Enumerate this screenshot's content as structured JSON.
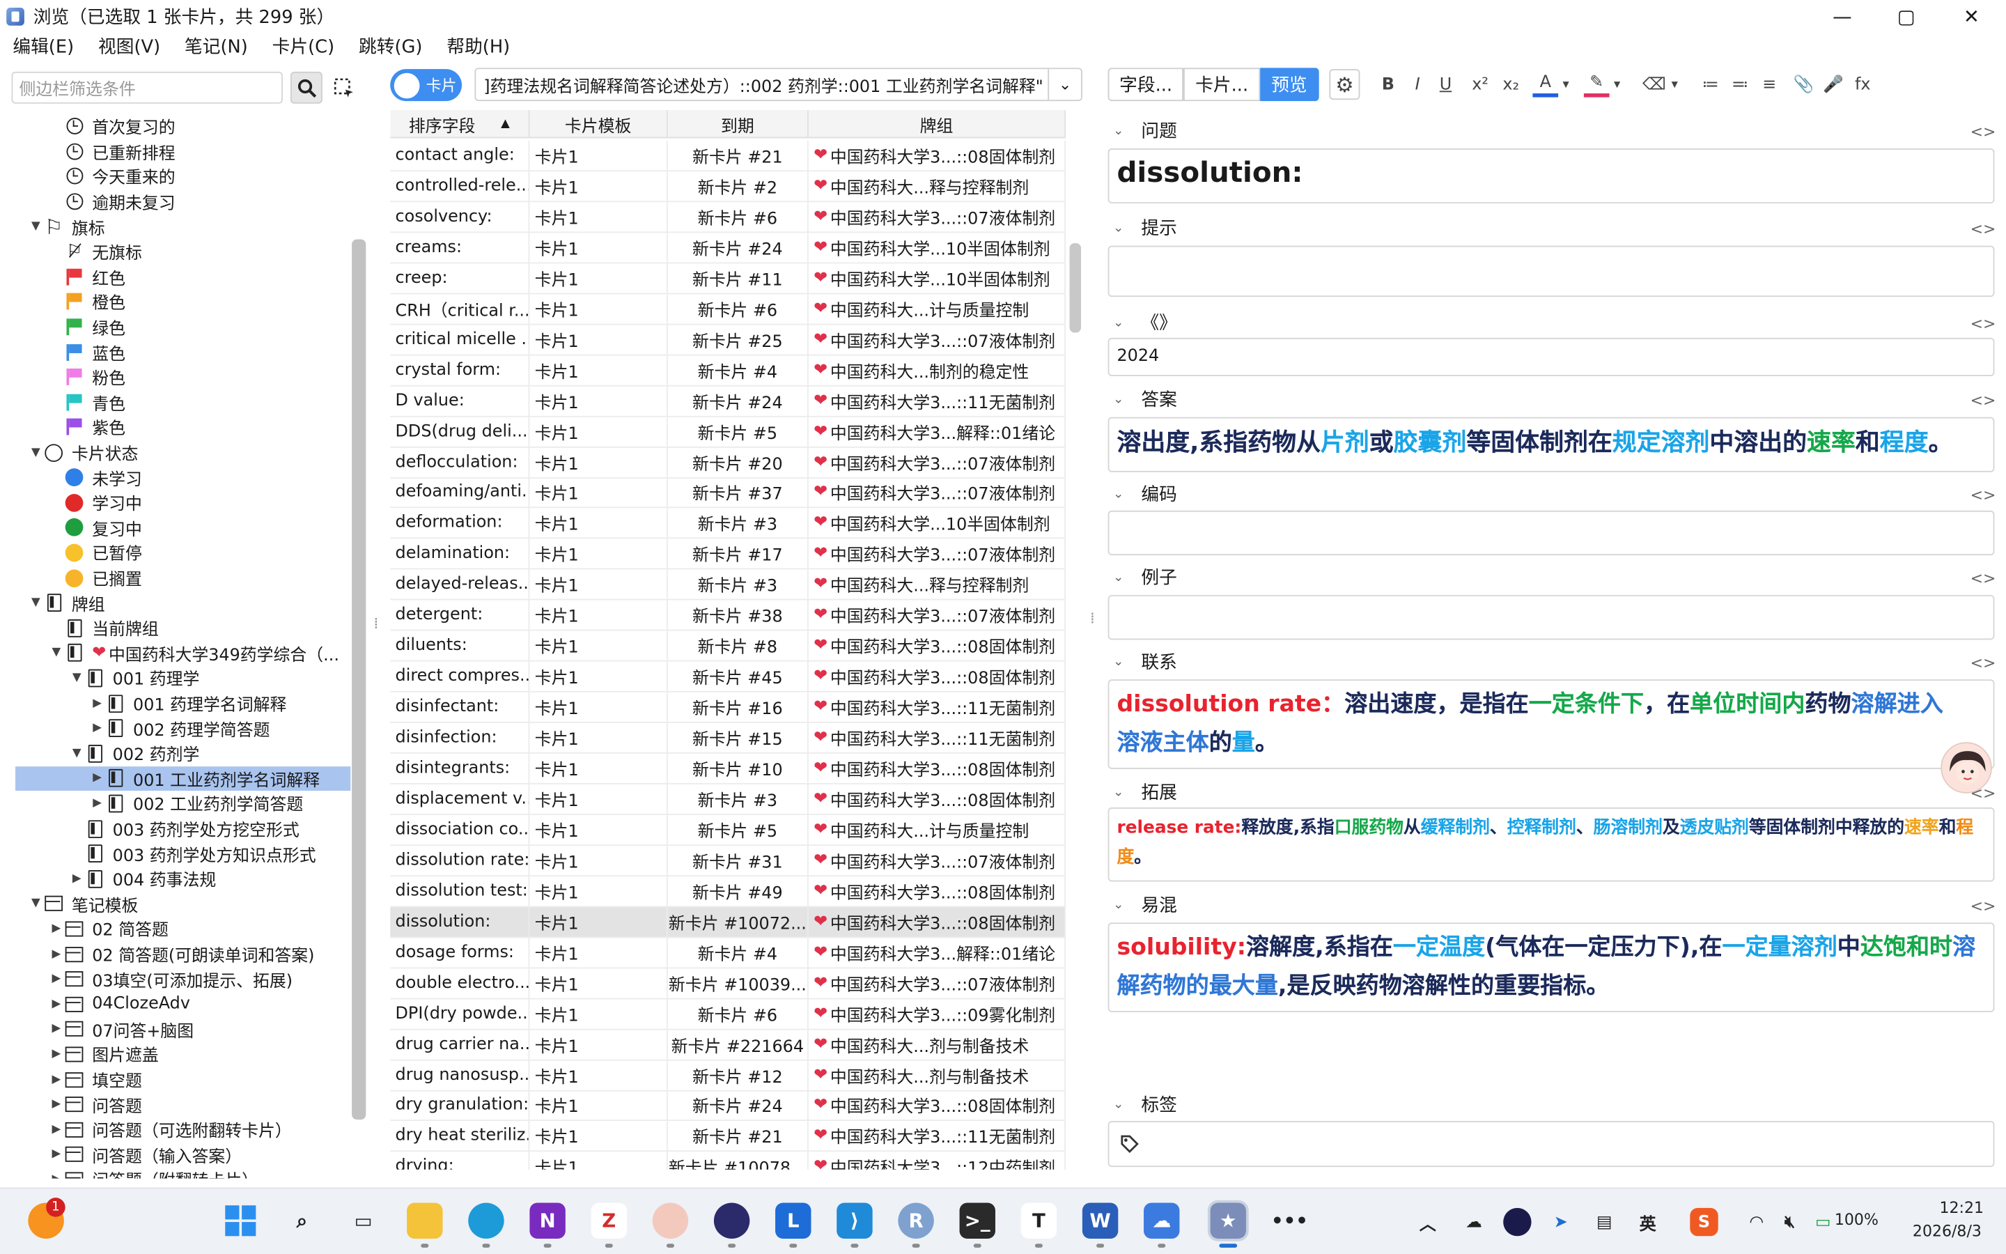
{
  "window": {
    "title": "浏览（已选取 1 张卡片，共 299 张）",
    "controls": [
      "—",
      "▢",
      "✕"
    ]
  },
  "menu": [
    "编辑(E)",
    "视图(V)",
    "笔记(N)",
    "卡片(C)",
    "跳转(G)",
    "帮助(H)"
  ],
  "sidebar": {
    "search_placeholder": "侧边栏筛选条件",
    "rows": [
      {
        "label": "首次复习的",
        "icon": "clock-icon",
        "indent": 1
      },
      {
        "label": "已重新排程",
        "icon": "clock-icon",
        "indent": 1
      },
      {
        "label": "今天重来的",
        "icon": "clock-icon",
        "indent": 1
      },
      {
        "label": "逾期未复习",
        "icon": "clock-icon",
        "indent": 1
      },
      {
        "label": "旗标",
        "icon": "flag-icon",
        "indent": 0,
        "expander": "▼"
      },
      {
        "label": "无旗标",
        "icon": "no-flag-icon",
        "indent": 1
      },
      {
        "label": "红色",
        "icon": "red-flag-icon",
        "indent": 1,
        "color": "#e8383d"
      },
      {
        "label": "橙色",
        "icon": "orange-flag-icon",
        "indent": 1,
        "color": "#f5a022"
      },
      {
        "label": "绿色",
        "icon": "green-flag-icon",
        "indent": 1,
        "color": "#33b24b"
      },
      {
        "label": "蓝色",
        "icon": "blue-flag-icon",
        "indent": 1,
        "color": "#3a8ee6"
      },
      {
        "label": "粉色",
        "icon": "pink-flag-icon",
        "indent": 1,
        "color": "#f07ce6"
      },
      {
        "label": "青色",
        "icon": "teal-flag-icon",
        "indent": 1,
        "color": "#27c4c4"
      },
      {
        "label": "紫色",
        "icon": "purple-flag-icon",
        "indent": 1,
        "color": "#9b4ee8"
      },
      {
        "label": "卡片状态",
        "icon": "circle-icon",
        "indent": 0,
        "expander": "▼"
      },
      {
        "label": "未学习",
        "icon": "blue-dot-icon",
        "indent": 1,
        "color": "#2f7fe8"
      },
      {
        "label": "学习中",
        "icon": "red-dot-icon",
        "indent": 1,
        "color": "#e02a2a"
      },
      {
        "label": "复习中",
        "icon": "green-dot-icon",
        "indent": 1,
        "color": "#1e9e3e"
      },
      {
        "label": "已暂停",
        "icon": "yellow-dot-icon",
        "indent": 1,
        "color": "#f7c12a"
      },
      {
        "label": "已搁置",
        "icon": "amber-dot-icon",
        "indent": 1,
        "color": "#f7b42a"
      },
      {
        "label": "牌组",
        "icon": "deck-icon",
        "indent": 0,
        "expander": "▼"
      },
      {
        "label": "当前牌组",
        "icon": "current-deck-icon",
        "indent": 1
      },
      {
        "label": "中国药科大学349药学综合（...",
        "icon": "deck-icon",
        "indent": 1,
        "expander": "▼",
        "heart": true
      },
      {
        "label": "001 药理学",
        "icon": "deck-icon",
        "indent": 2,
        "expander": "▼"
      },
      {
        "label": "001 药理学名词解释",
        "icon": "deck-icon",
        "indent": 3,
        "expander": "▶"
      },
      {
        "label": "002 药理学简答题",
        "icon": "deck-icon",
        "indent": 3,
        "expander": "▶"
      },
      {
        "label": "002 药剂学",
        "icon": "deck-icon",
        "indent": 2,
        "expander": "▼"
      },
      {
        "label": "001 工业药剂学名词解释",
        "icon": "deck-icon",
        "indent": 3,
        "expander": "▶",
        "selected": true
      },
      {
        "label": "002 工业药剂学简答题",
        "icon": "deck-icon",
        "indent": 3,
        "expander": "▶"
      },
      {
        "label": "003 药剂学处方挖空形式",
        "icon": "deck-icon",
        "indent": 2
      },
      {
        "label": "003 药剂学处方知识点形式",
        "icon": "deck-icon",
        "indent": 2
      },
      {
        "label": "004 药事法规",
        "icon": "deck-icon",
        "indent": 2,
        "expander": "▶"
      },
      {
        "label": "笔记模板",
        "icon": "note-type-icon",
        "indent": 0,
        "expander": "▼"
      },
      {
        "label": "02 简答题",
        "icon": "note-type-icon",
        "indent": 1,
        "expander": "▶"
      },
      {
        "label": "02 简答题(可朗读单词和答案)",
        "icon": "note-type-icon",
        "indent": 1,
        "expander": "▶"
      },
      {
        "label": "03填空(可添加提示、拓展)",
        "icon": "note-type-icon",
        "indent": 1,
        "expander": "▶"
      },
      {
        "label": "04ClozeAdv",
        "icon": "note-type-icon",
        "indent": 1,
        "expander": "▶"
      },
      {
        "label": "07问答+脑图",
        "icon": "note-type-icon",
        "indent": 1,
        "expander": "▶"
      },
      {
        "label": "图片遮盖",
        "icon": "note-type-icon",
        "indent": 1,
        "expander": "▶"
      },
      {
        "label": "填空题",
        "icon": "note-type-icon",
        "indent": 1,
        "expander": "▶"
      },
      {
        "label": "问答题",
        "icon": "note-type-icon",
        "indent": 1,
        "expander": "▶"
      },
      {
        "label": "问答题（可选附翻转卡片）",
        "icon": "note-type-icon",
        "indent": 1,
        "expander": "▶"
      },
      {
        "label": "问答题（输入答案）",
        "icon": "note-type-icon",
        "indent": 1,
        "expander": "▶"
      },
      {
        "label": "问答题（附翻转卡片）",
        "icon": "note-type-icon",
        "indent": 1,
        "expander": "▶"
      }
    ]
  },
  "browser": {
    "toggle_label": "卡片",
    "search_value": "]药理法规名词解释简答论述处方）::002 药剂学::001 工业药剂学名词解释\"",
    "columns": [
      "排序字段",
      "卡片模板",
      "到期",
      "牌组"
    ],
    "sort_indicator": "▲",
    "rows": [
      [
        "contact angle:",
        "卡片1",
        "新卡片 #21",
        "中国药科大学3...::08固体制剂"
      ],
      [
        "controlled-rele...",
        "卡片1",
        "新卡片 #2",
        "中国药科大...释与控释制剂"
      ],
      [
        "cosolvency:",
        "卡片1",
        "新卡片 #6",
        "中国药科大学3...::07液体制剂"
      ],
      [
        "creams:",
        "卡片1",
        "新卡片 #24",
        "中国药科大学...10半固体制剂"
      ],
      [
        "creep:",
        "卡片1",
        "新卡片 #11",
        "中国药科大学...10半固体制剂"
      ],
      [
        "CRH（critical r...",
        "卡片1",
        "新卡片 #6",
        "中国药科大...计与质量控制"
      ],
      [
        "critical micelle ...",
        "卡片1",
        "新卡片 #25",
        "中国药科大学3...::07液体制剂"
      ],
      [
        "crystal form:",
        "卡片1",
        "新卡片 #4",
        "中国药科大...制剂的稳定性"
      ],
      [
        "D value:",
        "卡片1",
        "新卡片 #24",
        "中国药科大学3...::11无菌制剂"
      ],
      [
        "DDS(drug deli...",
        "卡片1",
        "新卡片 #5",
        "中国药科大学3...解释::01绪论"
      ],
      [
        "deflocculation:",
        "卡片1",
        "新卡片 #20",
        "中国药科大学3...::07液体制剂"
      ],
      [
        "defoaming/anti...",
        "卡片1",
        "新卡片 #37",
        "中国药科大学3...::07液体制剂"
      ],
      [
        "deformation:",
        "卡片1",
        "新卡片 #3",
        "中国药科大学...10半固体制剂"
      ],
      [
        "delamination:",
        "卡片1",
        "新卡片 #17",
        "中国药科大学3...::07液体制剂"
      ],
      [
        "delayed-releas...",
        "卡片1",
        "新卡片 #3",
        "中国药科大...释与控释制剂"
      ],
      [
        "detergent:",
        "卡片1",
        "新卡片 #38",
        "中国药科大学3...::07液体制剂"
      ],
      [
        "diluents:",
        "卡片1",
        "新卡片 #8",
        "中国药科大学3...::08固体制剂"
      ],
      [
        "direct compres...",
        "卡片1",
        "新卡片 #45",
        "中国药科大学3...::08固体制剂"
      ],
      [
        "disinfectant:",
        "卡片1",
        "新卡片 #16",
        "中国药科大学3...::11无菌制剂"
      ],
      [
        "disinfection:",
        "卡片1",
        "新卡片 #15",
        "中国药科大学3...::11无菌制剂"
      ],
      [
        "disintegrants:",
        "卡片1",
        "新卡片 #10",
        "中国药科大学3...::08固体制剂"
      ],
      [
        "displacement v...",
        "卡片1",
        "新卡片 #3",
        "中国药科大学3...::08固体制剂"
      ],
      [
        "dissociation co...",
        "卡片1",
        "新卡片 #5",
        "中国药科大...计与质量控制"
      ],
      [
        "dissolution rate:",
        "卡片1",
        "新卡片 #31",
        "中国药科大学3...::07液体制剂"
      ],
      [
        "dissolution test:",
        "卡片1",
        "新卡片 #49",
        "中国药科大学3...::08固体制剂"
      ],
      [
        "dissolution:",
        "卡片1",
        "新卡片 #10072...",
        "中国药科大学3...::08固体制剂"
      ],
      [
        "dosage forms:",
        "卡片1",
        "新卡片 #4",
        "中国药科大学3...解释::01绪论"
      ],
      [
        "double electro...",
        "卡片1",
        "新卡片 #10039...",
        "中国药科大学3...::07液体制剂"
      ],
      [
        "DPI(dry powde...",
        "卡片1",
        "新卡片 #6",
        "中国药科大学3...::09雾化制剂"
      ],
      [
        "drug carrier na...",
        "卡片1",
        "新卡片 #221664",
        "中国药科大...剂与制备技术"
      ],
      [
        "drug nanosusp...",
        "卡片1",
        "新卡片 #12",
        "中国药科大...剂与制备技术"
      ],
      [
        "dry granulation:",
        "卡片1",
        "新卡片 #24",
        "中国药科大学3...::08固体制剂"
      ],
      [
        "dry heat steriliz...",
        "卡片1",
        "新卡片 #21",
        "中国药科大学3...::11无菌制剂"
      ],
      [
        "drying:",
        "卡片1",
        "新卡片 #10078...",
        "中国药科大学3...::12中药制剂"
      ]
    ],
    "selected_row": 25
  },
  "editor": {
    "tabs": [
      "字段...",
      "卡片...",
      "预览"
    ],
    "format_icons": [
      "B",
      "I",
      "U",
      "x²",
      "x₂",
      "A",
      "▾",
      "✎",
      "▾",
      "⌫",
      "▾",
      "≔",
      "≕",
      "≡",
      "📎",
      "🎤",
      "fx"
    ],
    "fields": {
      "question": {
        "label": "问题",
        "value": "dissolution:"
      },
      "hint": {
        "label": "提示",
        "value": ""
      },
      "source": {
        "label": "《》",
        "value": "2024"
      },
      "answer": {
        "label": "答案"
      },
      "code": {
        "label": "编码",
        "value": ""
      },
      "example": {
        "label": "例子",
        "value": ""
      },
      "relation": {
        "label": "联系"
      },
      "extension": {
        "label": "拓展"
      },
      "confusion": {
        "label": "易混"
      },
      "tags": {
        "label": "标签"
      }
    },
    "answer_segments": [
      {
        "t": "溶出度,系指药物从",
        "c": "navy"
      },
      {
        "t": "片剂",
        "c": "blue"
      },
      {
        "t": "或",
        "c": "navy"
      },
      {
        "t": "胶囊剂",
        "c": "blue"
      },
      {
        "t": "等固体制剂在",
        "c": "navy"
      },
      {
        "t": "规定溶剂",
        "c": "blue"
      },
      {
        "t": "中溶出的",
        "c": "navy"
      },
      {
        "t": "速率",
        "c": "green"
      },
      {
        "t": "和",
        "c": "navy"
      },
      {
        "t": "程度",
        "c": "blue"
      },
      {
        "t": "。",
        "c": "navy"
      }
    ],
    "relation_segments": [
      {
        "t": "dissolution rate：",
        "c": "red"
      },
      {
        "t": "溶出速度，是指在",
        "c": "navy"
      },
      {
        "t": "一定条件下",
        "c": "green"
      },
      {
        "t": "，在",
        "c": "navy"
      },
      {
        "t": "单位时间内",
        "c": "green"
      },
      {
        "t": "药物",
        "c": "navy"
      },
      {
        "t": "溶解进入溶液主体",
        "c": "blu2"
      },
      {
        "t": "的",
        "c": "navy"
      },
      {
        "t": "量",
        "c": "blue"
      },
      {
        "t": "。",
        "c": "navy"
      }
    ],
    "extension_segments": [
      {
        "t": "release rate:",
        "c": "red"
      },
      {
        "t": "释放度,系指",
        "c": "navy"
      },
      {
        "t": "口服药物",
        "c": "green"
      },
      {
        "t": "从",
        "c": "navy"
      },
      {
        "t": "缓释制剂",
        "c": "blue"
      },
      {
        "t": "、",
        "c": "navy"
      },
      {
        "t": "控释制剂",
        "c": "blue"
      },
      {
        "t": "、",
        "c": "navy"
      },
      {
        "t": "肠溶制剂",
        "c": "blue"
      },
      {
        "t": "及",
        "c": "navy"
      },
      {
        "t": "透皮贴剂",
        "c": "blue"
      },
      {
        "t": "等固体制剂中释放的",
        "c": "navy"
      },
      {
        "t": "速率",
        "c": "amber"
      },
      {
        "t": "和",
        "c": "navy"
      },
      {
        "t": "程度",
        "c": "orange"
      },
      {
        "t": "。",
        "c": "navy"
      }
    ],
    "confusion_segments": [
      {
        "t": "solubility:",
        "c": "red"
      },
      {
        "t": "溶解度,系指在",
        "c": "navy"
      },
      {
        "t": "一定温度",
        "c": "blue"
      },
      {
        "t": "(气体在一定压力下),在",
        "c": "navy"
      },
      {
        "t": "一定量溶剂",
        "c": "blue"
      },
      {
        "t": "中",
        "c": "navy"
      },
      {
        "t": "达饱和时",
        "c": "green"
      },
      {
        "t": "溶解药物的最大量",
        "c": "blu2"
      },
      {
        "t": ",是反映药物溶解性的重要指标。",
        "c": "navy"
      }
    ]
  },
  "taskbar": {
    "notification_count": "1",
    "battery": "100%",
    "time": "12:21",
    "date": "2026/8/3",
    "ime": "英"
  }
}
